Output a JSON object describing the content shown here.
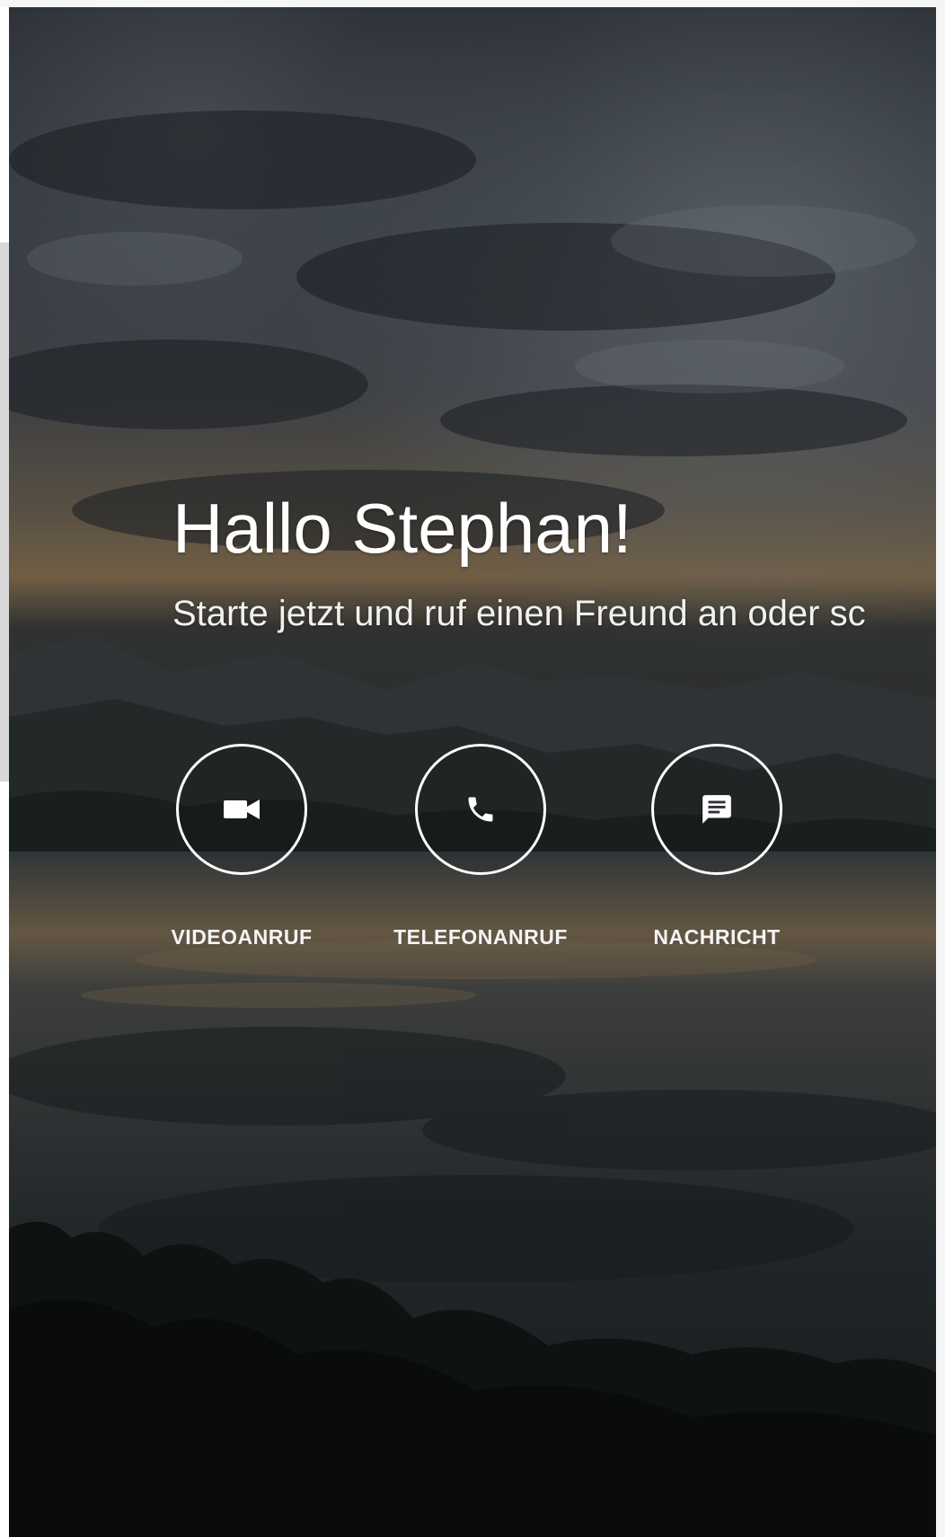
{
  "greeting": "Hallo Stephan!",
  "subtitle": "Starte jetzt und ruf einen Freund an oder sc",
  "actions": [
    {
      "label": "VIDEOANRUF",
      "icon": "videocam-icon"
    },
    {
      "label": "TELEFONANRUF",
      "icon": "phone-icon"
    },
    {
      "label": "NACHRICHT",
      "icon": "message-icon"
    }
  ],
  "colors": {
    "text": "#ffffff",
    "sky_dark": "#2b3036",
    "water_dark": "#1c2125",
    "glow": "#b58a5a"
  }
}
